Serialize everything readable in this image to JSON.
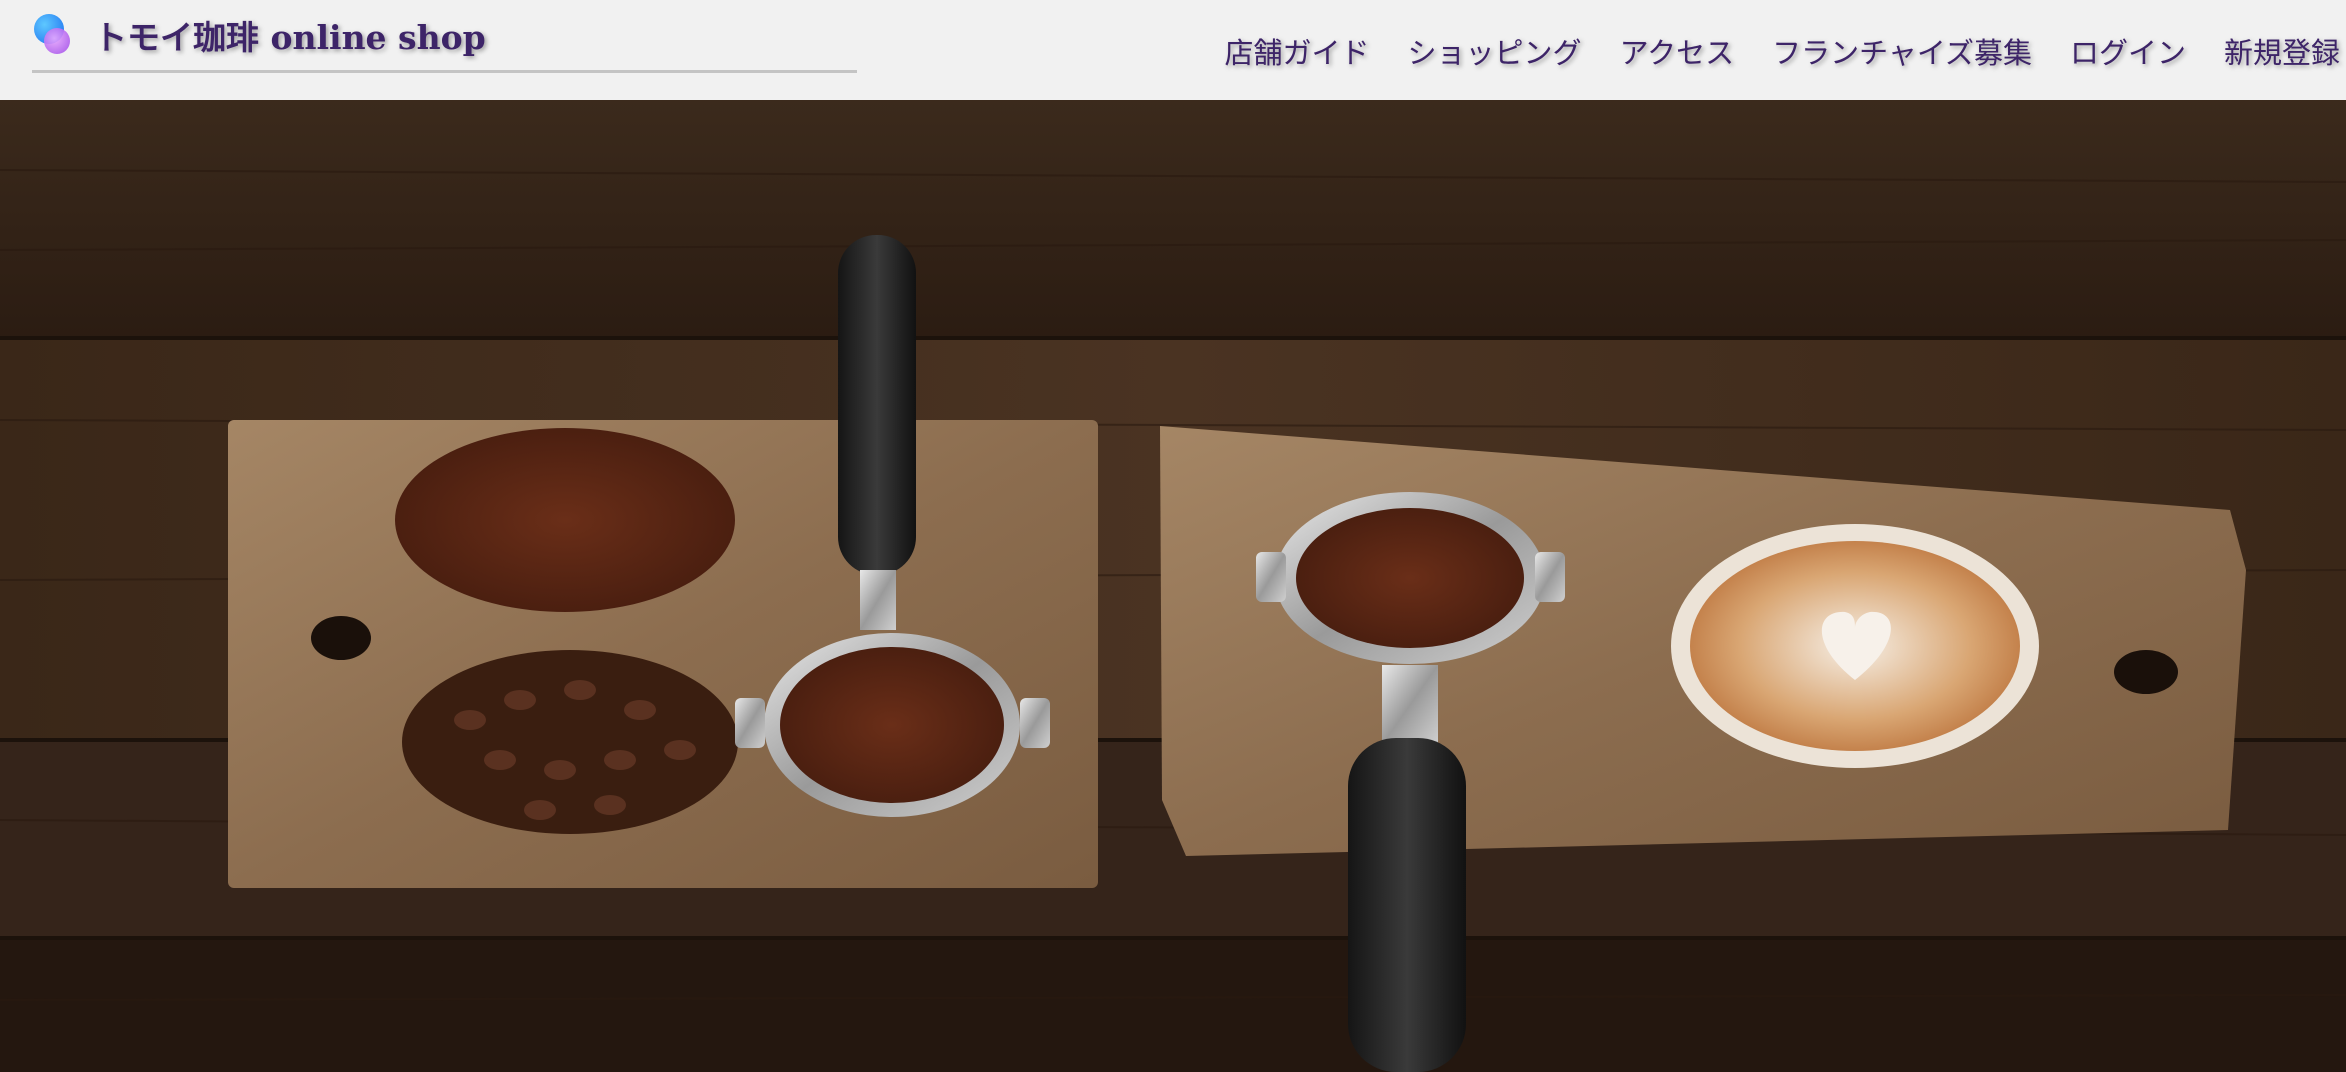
{
  "brand": {
    "title": "トモイ珈琲 online shop",
    "logo_icon": "overlapping-circles-logo-icon"
  },
  "nav": {
    "items": [
      {
        "label": "店舗ガイド"
      },
      {
        "label": "ショッピング"
      },
      {
        "label": "アクセス"
      },
      {
        "label": "フランチャイズ募集"
      },
      {
        "label": "ログイン"
      },
      {
        "label": "新規登録"
      }
    ]
  },
  "hero": {
    "image_subject": "coffee-hero-photo"
  },
  "colors": {
    "header_bg": "#f1f1f1",
    "nav_text": "#3d2468",
    "wood_dark": "#3a271a",
    "board_light": "#9a7a58"
  }
}
